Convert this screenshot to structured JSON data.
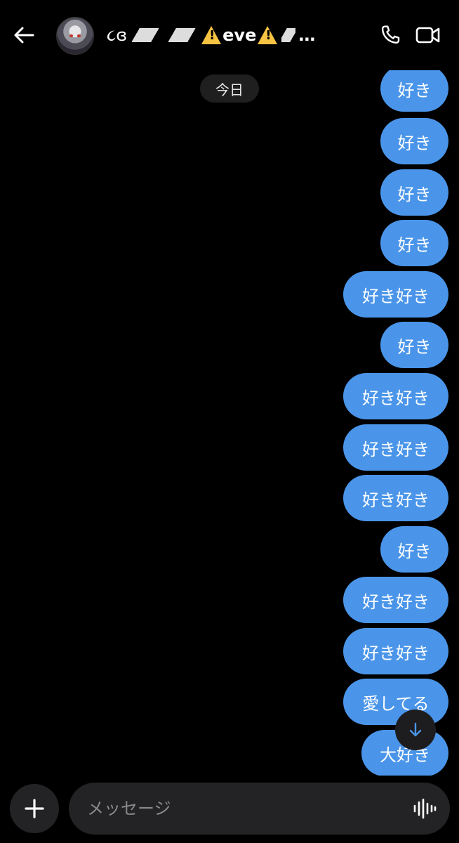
{
  "header": {
    "name_prefix": "૮ɞ",
    "name_core": "eve",
    "name_suffix": "…"
  },
  "chat": {
    "date_label": "今日",
    "messages": [
      {
        "text": "好き",
        "outgoing": true
      },
      {
        "text": "好き",
        "outgoing": true
      },
      {
        "text": "好き",
        "outgoing": true
      },
      {
        "text": "好き",
        "outgoing": true
      },
      {
        "text": "好き好き",
        "outgoing": true
      },
      {
        "text": "好き",
        "outgoing": true
      },
      {
        "text": "好き好き",
        "outgoing": true
      },
      {
        "text": "好き好き",
        "outgoing": true
      },
      {
        "text": "好き好き",
        "outgoing": true
      },
      {
        "text": "好き",
        "outgoing": true
      },
      {
        "text": "好き好き",
        "outgoing": true
      },
      {
        "text": "好き好き",
        "outgoing": true
      },
      {
        "text": "愛してる",
        "outgoing": true
      },
      {
        "text": "大好き",
        "outgoing": true
      }
    ]
  },
  "composer": {
    "placeholder": "メッセージ"
  },
  "colors": {
    "bubble": "#4a95e9",
    "background": "#000000",
    "scroll_arrow": "#4a95e9"
  },
  "icons": [
    "back-arrow-icon",
    "phone-icon",
    "video-camera-icon",
    "plus-icon",
    "voice-wave-icon",
    "arrow-down-icon"
  ]
}
